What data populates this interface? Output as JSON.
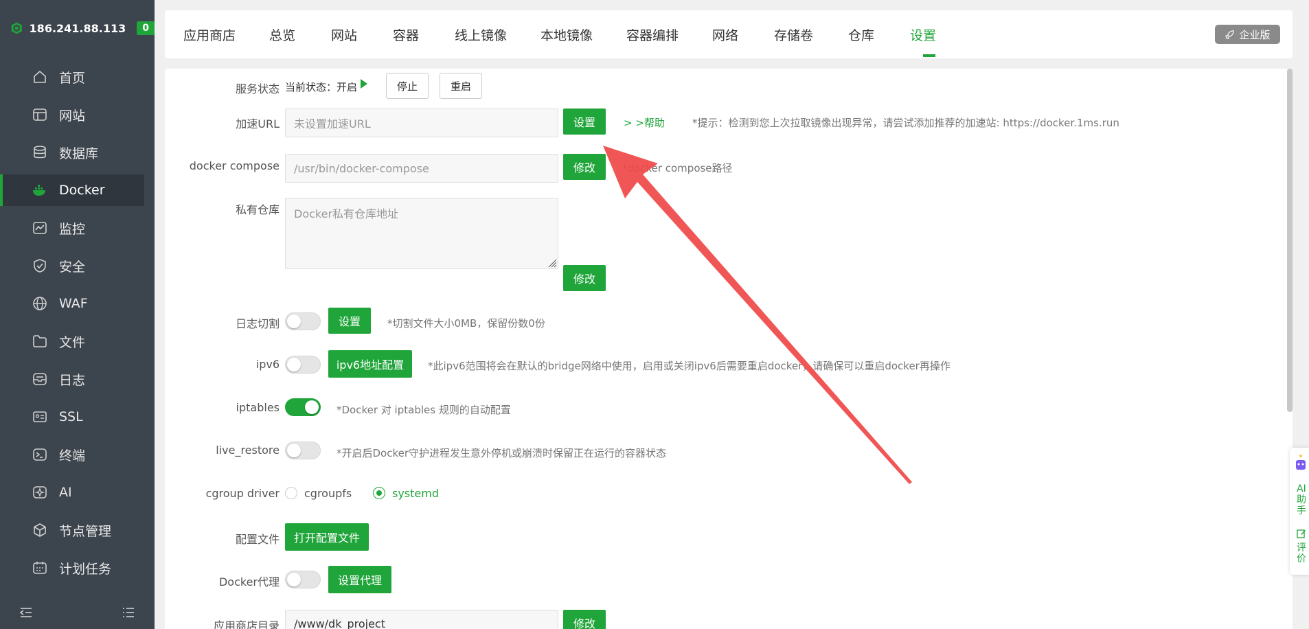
{
  "sidebar": {
    "ip": "186.241.88.113",
    "badge": "0",
    "items": [
      {
        "label": "首页",
        "icon": "home-icon"
      },
      {
        "label": "网站",
        "icon": "website-icon"
      },
      {
        "label": "数据库",
        "icon": "database-icon"
      },
      {
        "label": "Docker",
        "icon": "docker-icon",
        "active": true
      },
      {
        "label": "监控",
        "icon": "monitor-icon"
      },
      {
        "label": "安全",
        "icon": "shield-icon"
      },
      {
        "label": "WAF",
        "icon": "globe-icon"
      },
      {
        "label": "文件",
        "icon": "folder-icon"
      },
      {
        "label": "日志",
        "icon": "log-icon"
      },
      {
        "label": "SSL",
        "icon": "ssl-icon"
      },
      {
        "label": "终端",
        "icon": "terminal-icon"
      },
      {
        "label": "AI",
        "icon": "ai-icon"
      },
      {
        "label": "节点管理",
        "icon": "node-icon"
      },
      {
        "label": "计划任务",
        "icon": "calendar-icon"
      }
    ]
  },
  "tabs": [
    "应用商店",
    "总览",
    "网站",
    "容器",
    "线上镜像",
    "本地镜像",
    "容器编排",
    "网络",
    "存储卷",
    "仓库",
    "设置"
  ],
  "active_tab": "设置",
  "enterprise_label": "企业版",
  "settings": {
    "service_status": {
      "label": "服务状态",
      "current": "当前状态：开启",
      "stop": "停止",
      "restart": "重启"
    },
    "accel_url": {
      "label": "加速URL",
      "placeholder": "未设置加速URL",
      "button": "设置",
      "help": "> >帮助",
      "hint": "*提示：检测到您上次拉取镜像出现异常，请尝试添加推荐的加速站: https://docker.1ms.run"
    },
    "compose": {
      "label": "docker compose",
      "placeholder": "/usr/bin/docker-compose",
      "button": "修改",
      "hint": "*docker compose路径"
    },
    "registry": {
      "label": "私有仓库",
      "placeholder": "Docker私有仓库地址",
      "button": "修改"
    },
    "log_cut": {
      "label": "日志切割",
      "button": "设置",
      "hint": "*切割文件大小0MB，保留份数0份",
      "enabled": false
    },
    "ipv6": {
      "label": "ipv6",
      "button": "ipv6地址配置",
      "hint": "*此ipv6范围将会在默认的bridge网络中使用，启用或关闭ipv6后需要重启docker，请确保可以重启docker再操作",
      "enabled": false
    },
    "iptables": {
      "label": "iptables",
      "hint": "*Docker 对 iptables 规则的自动配置",
      "enabled": true
    },
    "live_restore": {
      "label": "live_restore",
      "hint": "*开启后Docker守护进程发生意外停机或崩溃时保留正在运行的容器状态",
      "enabled": false
    },
    "cgroup": {
      "label": "cgroup driver",
      "options": [
        "cgroupfs",
        "systemd"
      ],
      "selected": "systemd"
    },
    "config_file": {
      "label": "配置文件",
      "button": "打开配置文件"
    },
    "proxy": {
      "label": "Docker代理",
      "button": "设置代理",
      "enabled": false
    },
    "app_dir": {
      "label": "应用商店目录",
      "value": "/www/dk_project",
      "button": "修改"
    }
  },
  "ai_widget": {
    "label1": "AI助手",
    "label2": "评价"
  },
  "colors": {
    "accent": "#20a53a",
    "sidebar_bg": "#3c444d",
    "annotation_arrow": "#f04848"
  }
}
